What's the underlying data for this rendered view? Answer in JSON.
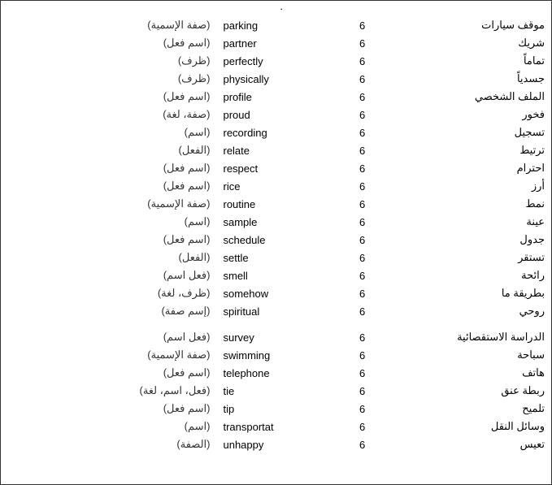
{
  "rows": [
    {
      "grammar": "(صفة الإسمية)",
      "english": "parking",
      "number": "6",
      "arabic": "موقف سيارات",
      "spacer": false
    },
    {
      "grammar": "(اسم فعل)",
      "english": "partner",
      "number": "6",
      "arabic": "شريك",
      "spacer": false
    },
    {
      "grammar": "(ظرف)",
      "english": "perfectly",
      "number": "6",
      "arabic": "تماماً",
      "spacer": false
    },
    {
      "grammar": "(ظرف)",
      "english": "physically",
      "number": "6",
      "arabic": "جسدياً",
      "spacer": false
    },
    {
      "grammar": "(اسم فعل)",
      "english": "profile",
      "number": "6",
      "arabic": "الملف الشخصي",
      "spacer": false
    },
    {
      "grammar": "(صفة، لغة)",
      "english": "proud",
      "number": "6",
      "arabic": "فخور",
      "spacer": false
    },
    {
      "grammar": "(اسم)",
      "english": "recording",
      "number": "6",
      "arabic": "تسجيل",
      "spacer": false
    },
    {
      "grammar": "(الفعل)",
      "english": "relate",
      "number": "6",
      "arabic": "ترتيط",
      "spacer": false
    },
    {
      "grammar": "(اسم فعل)",
      "english": "respect",
      "number": "6",
      "arabic": "احترام",
      "spacer": false
    },
    {
      "grammar": "(اسم فعل)",
      "english": "rice",
      "number": "6",
      "arabic": "أرز",
      "spacer": false
    },
    {
      "grammar": "(صفة الإسمية)",
      "english": "routine",
      "number": "6",
      "arabic": "نمط",
      "spacer": false
    },
    {
      "grammar": "(اسم)",
      "english": "sample",
      "number": "6",
      "arabic": "عينة",
      "spacer": false
    },
    {
      "grammar": "(اسم فعل)",
      "english": "schedule",
      "number": "6",
      "arabic": "جدول",
      "spacer": false
    },
    {
      "grammar": "(الفعل)",
      "english": "settle",
      "number": "6",
      "arabic": "تستقر",
      "spacer": false
    },
    {
      "grammar": "(فعل اسم)",
      "english": "smell",
      "number": "6",
      "arabic": "رائحة",
      "spacer": false
    },
    {
      "grammar": "(ظرف، لغة)",
      "english": "somehow",
      "number": "6",
      "arabic": "بطريقة ما",
      "spacer": false
    },
    {
      "grammar": "(إسم صفة)",
      "english": "spiritual",
      "number": "6",
      "arabic": "روحي",
      "spacer": false
    },
    {
      "grammar": "",
      "english": "",
      "number": "",
      "arabic": "",
      "spacer": true
    },
    {
      "grammar": "(فعل اسم)",
      "english": "survey",
      "number": "6",
      "arabic": "الدراسة الاستقصائية",
      "spacer": false
    },
    {
      "grammar": "(صفة الإسمية)",
      "english": "swimming",
      "number": "6",
      "arabic": "سباحة",
      "spacer": false
    },
    {
      "grammar": "(اسم فعل)",
      "english": "telephone",
      "number": "6",
      "arabic": "هاتف",
      "spacer": false
    },
    {
      "grammar": "(فعل، اسم، لغة)",
      "english": "tie",
      "number": "6",
      "arabic": "ربطة عنق",
      "spacer": false
    },
    {
      "grammar": "(اسم فعل)",
      "english": "tip",
      "number": "6",
      "arabic": "تلميح",
      "spacer": false
    },
    {
      "grammar": "(اسم)",
      "english": "transportat",
      "number": "6",
      "arabic": "وسائل النقل",
      "spacer": false
    },
    {
      "grammar": "(الصفة)",
      "english": "unhappy",
      "number": "6",
      "arabic": "تعيس",
      "spacer": false
    }
  ],
  "dot": "·"
}
